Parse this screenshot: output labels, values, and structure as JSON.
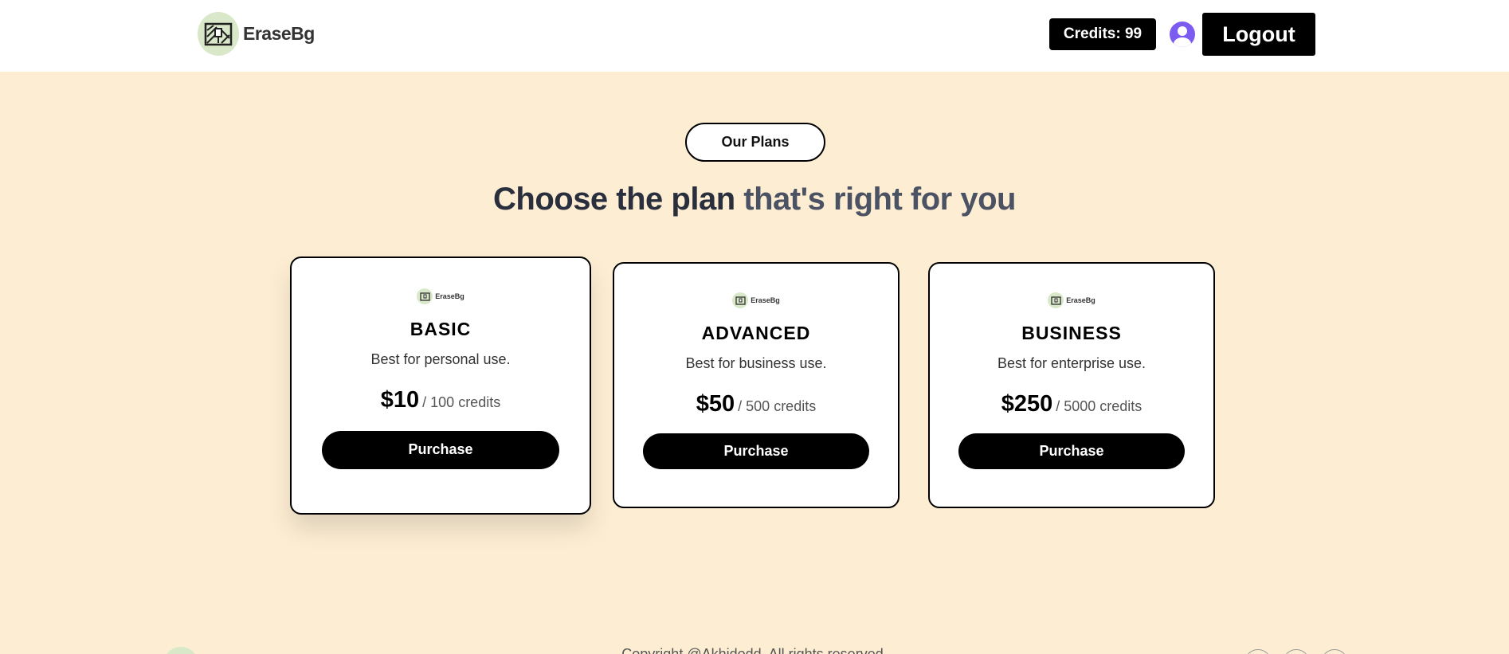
{
  "nav": {
    "brand": "EraseBg",
    "credits": "Credits: 99",
    "logout": "Logout"
  },
  "hero": {
    "pill": "Our Plans",
    "heading_part1": "Choose the plan",
    "heading_part2": " that's right for you"
  },
  "plans": [
    {
      "brand": "EraseBg",
      "name": "BASIC",
      "desc": "Best for personal use.",
      "price": "$10",
      "per": "/ 100 credits",
      "button": "Purchase"
    },
    {
      "brand": "EraseBg",
      "name": "ADVANCED",
      "desc": "Best for business use.",
      "price": "$50",
      "per": "/ 500 credits",
      "button": "Purchase"
    },
    {
      "brand": "EraseBg",
      "name": "BUSINESS",
      "desc": "Best for enterprise use.",
      "price": "$250",
      "per": "/ 5000 credits",
      "button": "Purchase"
    }
  ],
  "footer": {
    "copyright": "Copyright @Akhidodd. All rights reserved."
  },
  "colors": {
    "page_bg": "#fdeed3",
    "logo_bg": "#d9e8c8",
    "avatar": "#7c5cf0",
    "button_bg": "#000000"
  },
  "icons": [
    "brand-logo-icon",
    "user-avatar-icon",
    "social-icon"
  ]
}
